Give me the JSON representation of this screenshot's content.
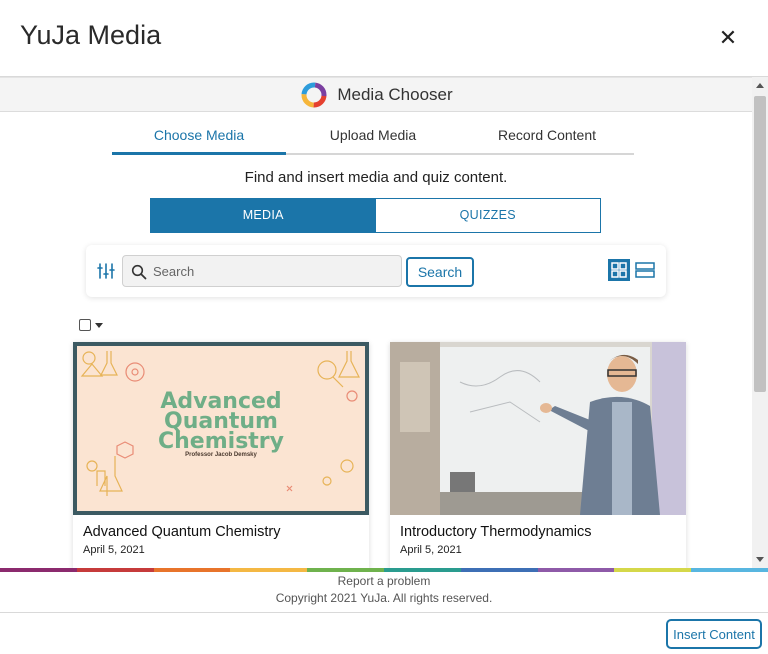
{
  "dialog": {
    "title": "YuJa Media",
    "close_glyph": "✕"
  },
  "chooser": {
    "title": "Media Chooser",
    "logo_icon": "yuja-logo-icon",
    "tabs": [
      {
        "label": "Choose Media",
        "active": true
      },
      {
        "label": "Upload Media",
        "active": false
      },
      {
        "label": "Record Content",
        "active": false
      }
    ],
    "subtitle": "Find and insert media and quiz content.",
    "segments": [
      {
        "label": "MEDIA",
        "active": true
      },
      {
        "label": "QUIZZES",
        "active": false
      }
    ]
  },
  "search": {
    "placeholder": "Search",
    "value": "",
    "button_label": "Search",
    "filter_icon": "filter-sliders-icon",
    "view_mode": "grid"
  },
  "media": [
    {
      "title": "Advanced Quantum Chemistry",
      "date": "April 5, 2021",
      "thumb_title_lines": [
        "Advanced",
        "Quantum",
        "Chemistry"
      ],
      "thumb_subtitle": "Professor Jacob Demsky"
    },
    {
      "title": "Introductory Thermodynamics",
      "date": "April 5, 2021"
    }
  ],
  "footer": {
    "report_link": "Report a problem",
    "copyright": "Copyright 2021 YuJa. All rights reserved.",
    "insert_label": "Insert Content"
  },
  "colors": {
    "accent": "#1b75a9",
    "rainbow": [
      "#8b2a6e",
      "#c63b3b",
      "#e8742b",
      "#f4b844",
      "#6fb24d",
      "#2a9c8f",
      "#3d6fb5",
      "#8e5aa8",
      "#d5d84a",
      "#58b6e0"
    ]
  }
}
